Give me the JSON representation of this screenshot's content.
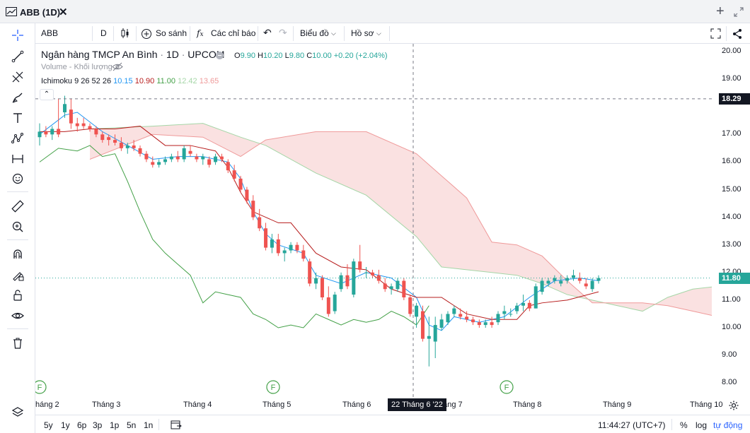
{
  "window": {
    "title": "ABB (1D)",
    "close_glyph": "✕",
    "add_glyph": "+"
  },
  "toolbar": {
    "symbol": "ABB",
    "interval": "D",
    "compare_label": "So sánh",
    "indicators_label": "Các chỉ báo",
    "chart_type_label": "Biểu đồ",
    "profile_label": "Hồ sơ"
  },
  "legend": {
    "company": "Ngân hàng TMCP An Bình",
    "interval": "1D",
    "exchange": "UPCOM",
    "o_label": "O",
    "o": "9.90",
    "h_label": "H",
    "h": "10.20",
    "l_label": "L",
    "l": "9.80",
    "c_label": "C",
    "c": "10.00",
    "change": "+0.20 (+2.04%)",
    "volume_label": "Volume - Khối lượng",
    "ichimoku_label": "Ichimoku 9 26 52 26",
    "ichimoku_values": [
      "10.15",
      "10.90",
      "11.00",
      "12.42",
      "13.65"
    ],
    "ichimoku_colors": [
      "#2196f3",
      "#b71c1c",
      "#43a047",
      "#a5d6a7",
      "#ef9a9a"
    ]
  },
  "price_axis": {
    "ticks": [
      "20.00",
      "19.00",
      "17.00",
      "16.00",
      "15.00",
      "14.00",
      "13.00",
      "12.00",
      "11.00",
      "10.00",
      "9.00",
      "8.00"
    ],
    "crosshair_price": "18.29",
    "last_price": "11.80"
  },
  "time_axis": {
    "ticks": [
      "háng 2",
      "Tháng 3",
      "Tháng 4",
      "Tháng 5",
      "Tháng 6",
      "háng 7",
      "Tháng 8",
      "Tháng 9",
      "Tháng 10"
    ],
    "crosshair_date": "22 Tháng 6 '22"
  },
  "markers": {
    "f_label": "F"
  },
  "bottom_bar": {
    "ranges": [
      "5y",
      "1y",
      "6p",
      "3p",
      "1p",
      "5n",
      "1n"
    ],
    "clock": "11:44:27 (UTC+7)",
    "percent": "%",
    "log": "log",
    "auto": "tự động"
  },
  "colors": {
    "up": "#26a69a",
    "down": "#ef5350",
    "tenkan": "#2196f3",
    "kijun": "#b71c1c",
    "chikou": "#43a047",
    "cloud_up": "#a5d6a7",
    "cloud_down": "#ef9a9a",
    "accent": "#2962ff"
  },
  "chart_data": {
    "type": "candlestick",
    "ylim": [
      7.7,
      20.3
    ],
    "candles": [
      [
        0,
        16.9,
        17.4,
        16.6,
        17.1
      ],
      [
        0.5,
        17.1,
        17.3,
        16.9,
        17.0
      ],
      [
        1,
        17.0,
        17.3,
        16.8,
        17.2
      ],
      [
        1.5,
        17.2,
        18.3,
        16.9,
        17.0
      ],
      [
        2,
        17.8,
        18.4,
        17.6,
        18.1
      ],
      [
        2.5,
        17.9,
        18.3,
        17.2,
        17.4
      ],
      [
        3,
        17.4,
        17.6,
        17.1,
        17.3
      ],
      [
        3.5,
        17.4,
        17.6,
        17.2,
        17.3
      ],
      [
        4,
        17.3,
        17.4,
        17.1,
        17.2
      ],
      [
        4.5,
        17.2,
        17.3,
        16.9,
        17.0
      ],
      [
        5,
        17.0,
        17.1,
        16.7,
        16.8
      ],
      [
        5.5,
        16.9,
        17.0,
        16.6,
        16.8
      ],
      [
        6,
        16.8,
        17.0,
        16.6,
        16.7
      ],
      [
        6.5,
        16.7,
        16.9,
        16.4,
        16.5
      ],
      [
        7,
        16.5,
        16.7,
        16.3,
        16.6
      ],
      [
        7.5,
        16.6,
        16.8,
        16.4,
        16.5
      ],
      [
        8,
        16.5,
        16.6,
        16.2,
        16.3
      ],
      [
        8.5,
        16.3,
        16.4,
        16.0,
        16.1
      ],
      [
        9,
        16.0,
        16.2,
        15.8,
        15.9
      ],
      [
        9.5,
        15.9,
        16.1,
        15.8,
        16.0
      ],
      [
        10,
        16.0,
        16.2,
        15.9,
        16.1
      ],
      [
        10.5,
        16.1,
        16.3,
        16.0,
        16.2
      ],
      [
        11,
        16.2,
        16.4,
        16.0,
        16.1
      ],
      [
        11.5,
        16.1,
        16.6,
        16.0,
        16.5
      ],
      [
        12,
        16.4,
        16.6,
        16.2,
        16.3
      ],
      [
        12.5,
        16.2,
        16.3,
        16.0,
        16.1
      ],
      [
        13,
        16.1,
        16.3,
        15.9,
        16.2
      ],
      [
        13.5,
        16.1,
        16.2,
        15.8,
        15.9
      ],
      [
        14,
        16.0,
        16.3,
        15.9,
        16.2
      ],
      [
        14.5,
        16.2,
        16.3,
        16.0,
        16.1
      ],
      [
        15,
        16.0,
        16.1,
        15.6,
        15.7
      ],
      [
        15.5,
        15.7,
        15.9,
        15.3,
        15.4
      ],
      [
        16,
        15.4,
        15.5,
        14.9,
        15.0
      ],
      [
        16.5,
        15.0,
        15.1,
        14.5,
        14.6
      ],
      [
        17,
        14.6,
        14.8,
        13.9,
        14.0
      ],
      [
        17.5,
        14.0,
        14.3,
        13.5,
        13.6
      ],
      [
        18,
        13.6,
        13.8,
        12.8,
        12.9
      ],
      [
        18.5,
        12.9,
        13.4,
        12.7,
        13.2
      ],
      [
        19,
        13.2,
        13.4,
        12.6,
        12.7
      ],
      [
        19.5,
        12.7,
        12.9,
        12.4,
        12.8
      ],
      [
        20,
        12.8,
        13.1,
        12.7,
        13.0
      ],
      [
        20.5,
        13.0,
        13.1,
        12.7,
        12.8
      ],
      [
        21,
        12.8,
        13.0,
        12.4,
        12.5
      ],
      [
        21.5,
        12.4,
        12.5,
        11.5,
        11.6
      ],
      [
        22,
        11.6,
        12.0,
        11.4,
        11.8
      ],
      [
        22.5,
        11.8,
        11.9,
        11.0,
        11.1
      ],
      [
        23,
        11.1,
        11.5,
        10.4,
        10.5
      ],
      [
        23.5,
        10.6,
        11.3,
        10.5,
        11.2
      ],
      [
        24,
        11.4,
        12.0,
        11.3,
        11.9
      ],
      [
        24.5,
        11.9,
        12.3,
        11.4,
        11.5
      ],
      [
        25,
        11.2,
        12.5,
        11.1,
        12.4
      ],
      [
        25.5,
        12.4,
        13.0,
        12.0,
        12.1
      ],
      [
        26,
        12.0,
        12.2,
        11.8,
        12.0
      ],
      [
        26.5,
        12.0,
        12.1,
        11.8,
        11.9
      ],
      [
        27,
        11.9,
        12.1,
        11.6,
        11.7
      ],
      [
        27.5,
        11.6,
        11.8,
        11.3,
        11.4
      ],
      [
        28,
        11.4,
        11.6,
        11.2,
        11.5
      ],
      [
        28.5,
        11.4,
        11.8,
        11.3,
        11.7
      ],
      [
        29,
        11.7,
        11.8,
        11.0,
        11.1
      ],
      [
        29.5,
        11.1,
        11.2,
        10.4,
        10.5
      ],
      [
        30,
        10.4,
        10.9,
        10.0,
        10.8
      ],
      [
        30.5,
        10.6,
        10.8,
        9.5,
        9.6
      ],
      [
        31,
        9.6,
        10.4,
        8.6,
        9.7
      ],
      [
        31.5,
        9.5,
        10.4,
        8.9,
        10.1
      ],
      [
        32,
        10.0,
        10.5,
        9.9,
        10.3
      ],
      [
        32.5,
        10.2,
        10.6,
        10.1,
        10.5
      ],
      [
        33,
        10.5,
        10.8,
        10.4,
        10.7
      ],
      [
        33.5,
        10.5,
        10.7,
        10.3,
        10.4
      ],
      [
        34,
        10.4,
        10.6,
        10.2,
        10.3
      ],
      [
        34.5,
        10.3,
        10.4,
        10.1,
        10.2
      ],
      [
        35,
        10.2,
        10.3,
        10.0,
        10.1
      ],
      [
        35.5,
        10.1,
        10.3,
        10.0,
        10.2
      ],
      [
        36,
        10.2,
        10.4,
        10.0,
        10.1
      ],
      [
        36.5,
        10.2,
        10.6,
        10.1,
        10.5
      ],
      [
        37,
        10.5,
        10.8,
        10.3,
        10.6
      ],
      [
        37.5,
        10.5,
        10.7,
        10.4,
        10.5
      ],
      [
        38,
        10.6,
        10.9,
        10.5,
        10.8
      ],
      [
        38.5,
        10.8,
        11.2,
        10.6,
        10.9
      ],
      [
        39,
        10.9,
        11.0,
        10.6,
        10.7
      ],
      [
        39.5,
        10.7,
        11.6,
        10.7,
        11.5
      ],
      [
        40,
        11.3,
        11.8,
        11.2,
        11.7
      ],
      [
        40.5,
        11.6,
        11.8,
        11.5,
        11.7
      ],
      [
        41,
        11.7,
        11.9,
        11.6,
        11.8
      ],
      [
        41.5,
        11.6,
        11.9,
        11.5,
        11.7
      ],
      [
        42,
        11.7,
        11.9,
        11.6,
        11.8
      ],
      [
        42.5,
        11.8,
        12.1,
        11.7,
        11.9
      ],
      [
        43,
        11.8,
        12.0,
        11.6,
        11.7
      ],
      [
        43.5,
        11.6,
        11.8,
        11.4,
        11.5
      ],
      [
        44,
        11.4,
        11.8,
        11.3,
        11.7
      ],
      [
        44.5,
        11.7,
        11.9,
        11.6,
        11.8
      ]
    ],
    "series": [
      {
        "name": "Tenkan",
        "x": [
          0,
          2,
          3,
          5,
          7,
          9,
          11,
          13,
          15,
          16,
          17,
          18,
          19,
          21,
          22,
          24,
          26,
          28,
          30,
          31,
          32,
          33,
          35,
          37,
          39,
          41,
          43,
          44.5
        ],
        "y": [
          17.0,
          17.7,
          17.8,
          17.1,
          16.6,
          16.1,
          16.2,
          16.2,
          16.0,
          15.4,
          14.2,
          13.4,
          13.0,
          12.7,
          11.9,
          11.6,
          12.0,
          11.8,
          11.1,
          10.1,
          9.9,
          10.4,
          10.2,
          10.4,
          11.1,
          11.7,
          11.8,
          11.7
        ]
      },
      {
        "name": "Kijun",
        "x": [
          0,
          2,
          4,
          6,
          8,
          10,
          12,
          14,
          15,
          16,
          17,
          18,
          19,
          20,
          22,
          24,
          26,
          28,
          30,
          31,
          32,
          34,
          36,
          38,
          39,
          40,
          42,
          44.5
        ],
        "y": [
          17.1,
          17.1,
          17.2,
          17.2,
          17.3,
          16.6,
          16.6,
          16.4,
          15.8,
          14.9,
          14.2,
          14.0,
          13.8,
          13.8,
          12.7,
          12.2,
          12.1,
          11.4,
          11.1,
          11.1,
          11.1,
          10.5,
          10.3,
          10.3,
          10.8,
          10.9,
          11.0,
          11.3
        ]
      },
      {
        "name": "Chikou",
        "x": [
          0,
          1.5,
          3,
          4,
          5,
          6,
          7,
          8,
          9,
          10,
          11,
          12,
          13,
          14,
          15,
          16,
          17,
          18,
          19,
          20,
          21,
          22,
          23,
          24,
          25,
          26,
          27,
          28,
          29,
          30,
          31
        ],
        "y": [
          16.0,
          16.5,
          16.4,
          16.6,
          16.2,
          16.3,
          15.3,
          14.2,
          13.2,
          12.7,
          12.3,
          11.9,
          10.9,
          11.3,
          11.2,
          11.1,
          10.5,
          10.3,
          10.0,
          10.1,
          10.0,
          10.5,
          10.3,
          10.1,
          10.3,
          10.2,
          10.3,
          10.6,
          10.4,
          10.1,
          10.8
        ]
      }
    ]
  }
}
